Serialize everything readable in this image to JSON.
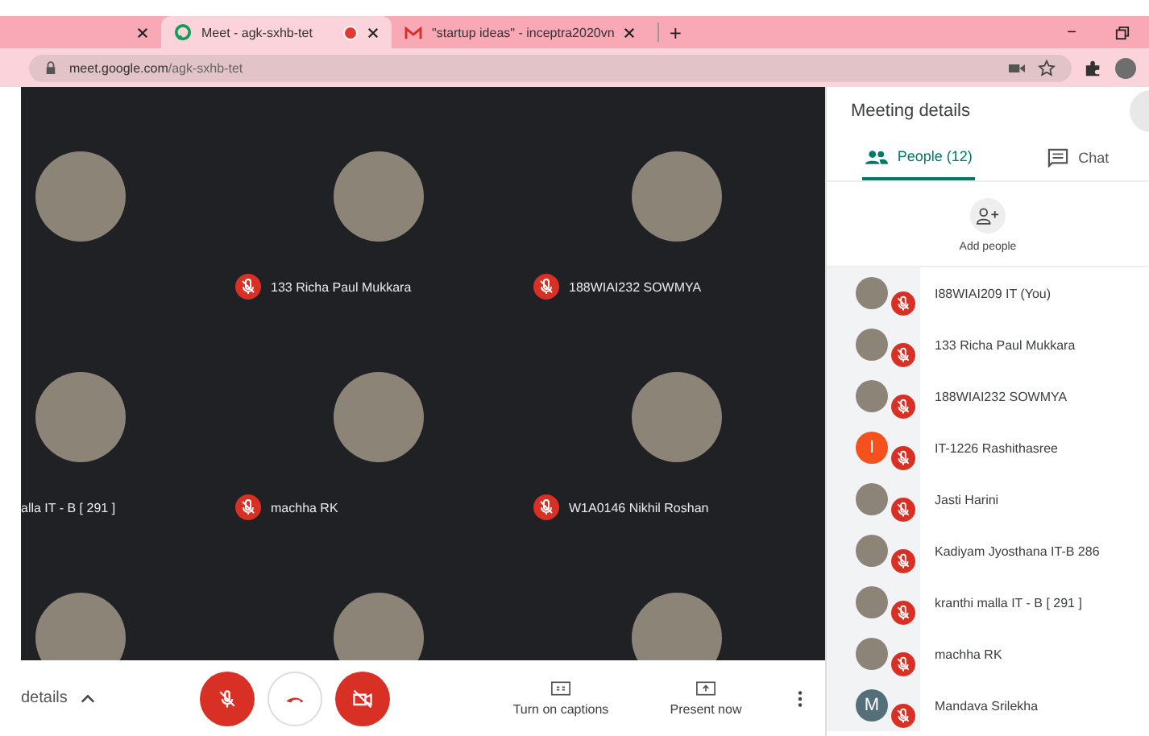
{
  "browser": {
    "tabs": [
      {
        "selected": false
      },
      {
        "kind": "meet",
        "title": "Meet - agk-sxhb-tet",
        "selected": true,
        "recording": true
      },
      {
        "kind": "mail",
        "title": "\"startup ideas\" - inceptra2020vn",
        "selected": false,
        "recording": false
      }
    ],
    "new_tab": "+",
    "minimize": "−",
    "address": {
      "host": "meet.google.com",
      "path": "/agk-sxhb-tet"
    }
  },
  "grid": {
    "rows": [
      [
        {},
        {
          "name": "133 Richa Paul Mukkara",
          "muted": true
        },
        {
          "name": "188WIAI232 SOWMYA",
          "muted": true
        }
      ],
      [
        {
          "name": "alla IT - B [ 291 ]"
        },
        {
          "name": "machha RK",
          "muted": true
        },
        {
          "name": "W1A0146 Nikhil Roshan",
          "muted": true
        }
      ],
      [
        {},
        {},
        {}
      ]
    ]
  },
  "controls": {
    "details": "details",
    "captions": "Turn on captions",
    "present": "Present now",
    "mic_off": true,
    "camera_off": true
  },
  "panel": {
    "title": "Meeting details",
    "tabs": [
      {
        "label": "People (12)",
        "selected": true
      },
      {
        "label": "Chat",
        "selected": false
      }
    ],
    "add_people": "Add people",
    "people": [
      {
        "name": "I88WIAI209 IT (You)",
        "muted": true
      },
      {
        "name": "133 Richa Paul Mukkara",
        "muted": true
      },
      {
        "name": "188WIAI232 SOWMYA",
        "muted": true
      },
      {
        "name": "IT-1226 Rashithasree",
        "initial": "I",
        "color": "#f4511e",
        "muted": true
      },
      {
        "name": "Jasti Harini",
        "muted": true
      },
      {
        "name": "Kadiyam Jyosthana IT-B 286",
        "muted": true
      },
      {
        "name": "kranthi malla IT - B [ 291 ]",
        "muted": true
      },
      {
        "name": "machha RK",
        "muted": true
      },
      {
        "name": "Mandava Srilekha",
        "initial": "M",
        "color": "#546e7a",
        "muted": true
      }
    ]
  }
}
